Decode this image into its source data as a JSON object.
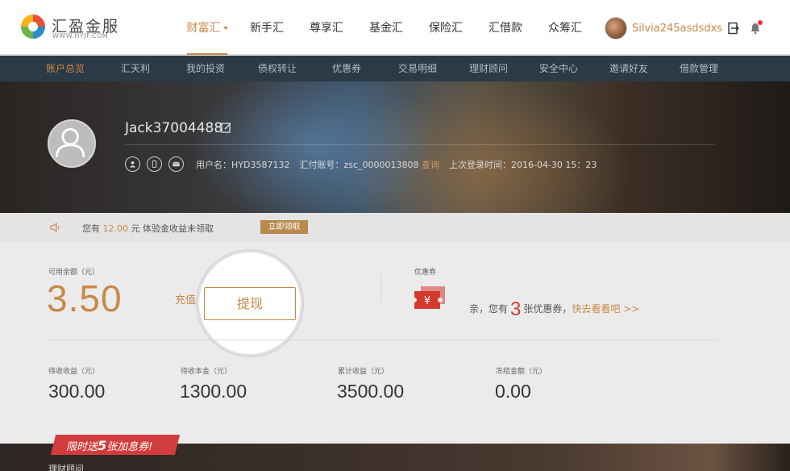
{
  "brand": {
    "name_cn": "汇盈金服",
    "name_en": "WWW.HYJF.COM"
  },
  "main_nav": [
    {
      "label": "财富汇",
      "active": true
    },
    {
      "label": "新手汇",
      "active": false
    },
    {
      "label": "尊享汇",
      "active": false
    },
    {
      "label": "基金汇",
      "active": false
    },
    {
      "label": "保险汇",
      "active": false
    },
    {
      "label": "汇借款",
      "active": false
    },
    {
      "label": "众筹汇",
      "active": false
    }
  ],
  "user": {
    "username": "Silvia245asdsdxs"
  },
  "sub_nav": [
    {
      "label": "账户总览",
      "active": true
    },
    {
      "label": "汇天利",
      "active": false
    },
    {
      "label": "我的投资",
      "active": false
    },
    {
      "label": "债权转让",
      "active": false
    },
    {
      "label": "优惠券",
      "active": false
    },
    {
      "label": "交易明细",
      "active": false
    },
    {
      "label": "理财顾问",
      "active": false
    },
    {
      "label": "安全中心",
      "active": false
    },
    {
      "label": "邀请好友",
      "active": false
    },
    {
      "label": "借款管理",
      "active": false
    }
  ],
  "profile": {
    "display_name": "Jack37004488",
    "username_label": "用户名：",
    "username_value": "HYD3587132",
    "account_label": "汇付账号：",
    "account_value": "zsc_0000013808",
    "query_label": "查询",
    "last_login_label": "上次登录时间：",
    "last_login_value": "2016-04-30  15：23"
  },
  "notice": {
    "prefix": "您有 ",
    "amount": "12.00",
    "suffix": " 元 体验金收益未领取",
    "button": "立即领取"
  },
  "balance": {
    "label": "可用余额（元）",
    "value": "3.50",
    "recharge": "充值",
    "withdraw": "提现"
  },
  "coupons": {
    "label": "优惠券",
    "prefix": "亲，您有",
    "count": "3",
    "suffix": "张优惠券，",
    "link": "快去看看吧 >>"
  },
  "stats": [
    {
      "label": "待收收益（元）",
      "value": "300.00"
    },
    {
      "label": "待收本金（元）",
      "value": "1300.00"
    },
    {
      "label": "累计收益（元）",
      "value": "3500.00"
    },
    {
      "label": "冻结金额（元）",
      "value": "0.00"
    }
  ],
  "promo": {
    "prefix": "限时送",
    "num": "5",
    "suffix": "张加息券!"
  },
  "bottom_label": "理财顾问",
  "colors": {
    "accent": "#c8894a",
    "subnav_bg": "#2b3a46",
    "alert_red": "#d33c3c"
  }
}
